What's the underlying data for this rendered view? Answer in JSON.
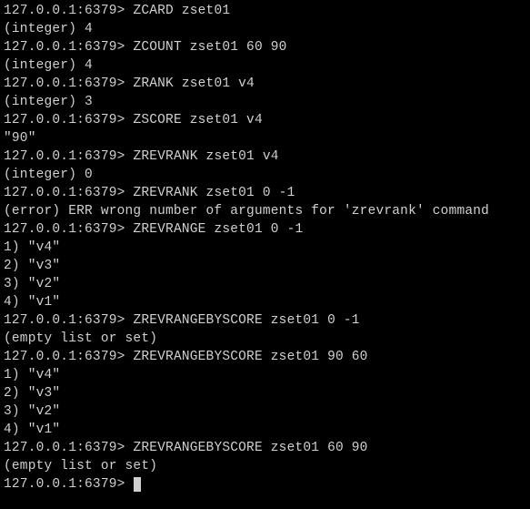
{
  "prompt": "127.0.0.1:6379> ",
  "lines": [
    {
      "type": "cmd",
      "text": "ZCARD zset01"
    },
    {
      "type": "out",
      "text": "(integer) 4"
    },
    {
      "type": "cmd",
      "text": "ZCOUNT zset01 60 90"
    },
    {
      "type": "out",
      "text": "(integer) 4"
    },
    {
      "type": "cmd",
      "text": "ZRANK zset01 v4"
    },
    {
      "type": "out",
      "text": "(integer) 3"
    },
    {
      "type": "cmd",
      "text": "ZSCORE zset01 v4"
    },
    {
      "type": "out",
      "text": "\"90\""
    },
    {
      "type": "cmd",
      "text": "ZREVRANK zset01 v4"
    },
    {
      "type": "out",
      "text": "(integer) 0"
    },
    {
      "type": "cmd",
      "text": "ZREVRANK zset01 0 -1"
    },
    {
      "type": "out",
      "text": "(error) ERR wrong number of arguments for 'zrevrank' command"
    },
    {
      "type": "cmd",
      "text": "ZREVRANGE zset01 0 -1"
    },
    {
      "type": "out",
      "text": "1) \"v4\""
    },
    {
      "type": "out",
      "text": "2) \"v3\""
    },
    {
      "type": "out",
      "text": "3) \"v2\""
    },
    {
      "type": "out",
      "text": "4) \"v1\""
    },
    {
      "type": "cmd",
      "text": "ZREVRANGEBYSCORE zset01 0 -1"
    },
    {
      "type": "out",
      "text": "(empty list or set)"
    },
    {
      "type": "cmd",
      "text": "ZREVRANGEBYSCORE zset01 90 60"
    },
    {
      "type": "out",
      "text": "1) \"v4\""
    },
    {
      "type": "out",
      "text": "2) \"v3\""
    },
    {
      "type": "out",
      "text": "3) \"v2\""
    },
    {
      "type": "out",
      "text": "4) \"v1\""
    },
    {
      "type": "cmd",
      "text": "ZREVRANGEBYSCORE zset01 60 90"
    },
    {
      "type": "out",
      "text": "(empty list or set)"
    },
    {
      "type": "cmd",
      "text": "",
      "cursor": true
    }
  ]
}
